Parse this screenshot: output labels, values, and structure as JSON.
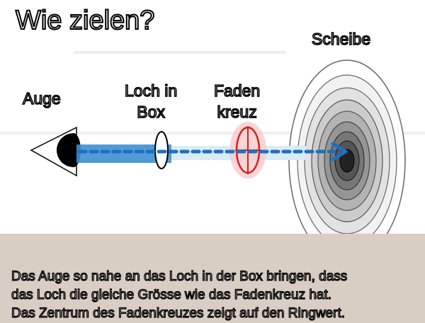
{
  "title": "Wie zielen?",
  "labels": {
    "scheibe": "Scheibe",
    "auge": "Auge",
    "loch_line1": "Loch in",
    "loch_line2": "Box",
    "faden_line1": "Faden",
    "faden_line2": "kreuz"
  },
  "caption": {
    "line1": "Das Auge so nahe an das Loch in der Box bringen, dass",
    "line2": "das Loch die gleiche Grösse wie das Fadenkreuz hat.",
    "line3": "Das Zentrum des Fadenkreuzes zeigt auf den Ringwert."
  },
  "colors": {
    "sight_line": "#3d8fd0",
    "arrow": "#1e6fc0",
    "crosshair": "#d42020",
    "caption_bg": "#d8cec4"
  }
}
